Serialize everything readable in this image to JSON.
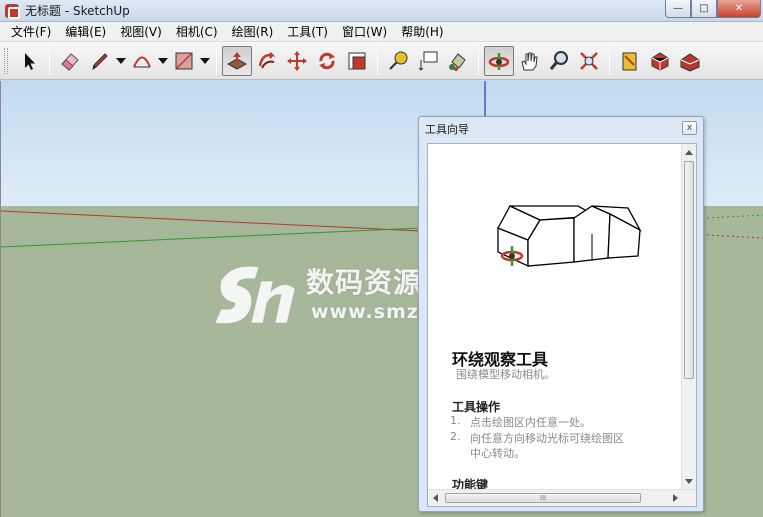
{
  "window": {
    "title": "无标题 - SketchUp",
    "min_glyph": "—",
    "max_glyph": "□",
    "close_glyph": "✕"
  },
  "menu": {
    "items": [
      "文件(F)",
      "编辑(E)",
      "视图(V)",
      "相机(C)",
      "绘图(R)",
      "工具(T)",
      "窗口(W)",
      "帮助(H)"
    ]
  },
  "toolbar": {
    "tools": [
      "select-icon",
      "eraser-icon",
      "pencil-icon",
      "arc-icon",
      "rectangle-icon",
      "push-pull-icon",
      "follow-me-icon",
      "move-icon",
      "rotate-icon",
      "offset-icon",
      "tape-measure-icon",
      "text-icon",
      "paint-bucket-icon",
      "orbit-icon",
      "pan-icon",
      "zoom-icon",
      "zoom-extents-icon",
      "section-icon",
      "component-icon",
      "warehouse-icon"
    ],
    "active_tool": "orbit-icon"
  },
  "watermark": {
    "title": "数码资源网",
    "url": "www.smzy.com"
  },
  "instructor": {
    "title": "工具向导",
    "close_glyph": "x",
    "tool_name": "环绕观察工具",
    "description": "围绕模型移动相机。",
    "section_ops": "工具操作",
    "step1_num": "1.",
    "step1": "点击绘图区内任意一处。",
    "step2_num": "2.",
    "step2": "向任意方向移动光标可绕绘图区",
    "step2_cont": "中心转动。",
    "section_keys": "功能键",
    "scroll_grip": "III"
  },
  "colors": {
    "sky": "#c2daf0",
    "ground": "#a7b79a",
    "red_axis": "#b03a2e",
    "green_axis": "#2e9b2e",
    "blue_axis": "#1f3fa3",
    "panel_bg": "#dbe7f4"
  }
}
